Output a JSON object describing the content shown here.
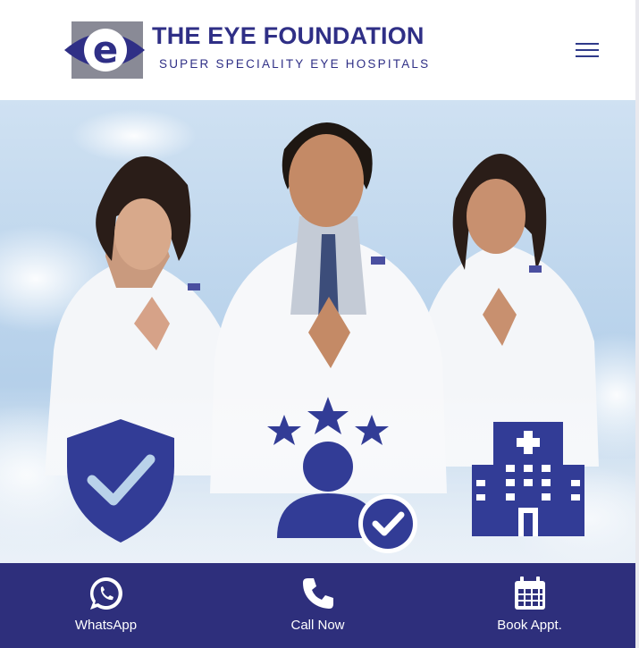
{
  "brand": {
    "logo_letter": "e",
    "title": "THE EYE FOUNDATION",
    "subtitle": "SUPER SPECIALITY EYE HOSPITALS"
  },
  "header": {
    "menu_icon": "hamburger-icon"
  },
  "hero": {
    "image": "doctors-namaste-photo",
    "icons": [
      "shield-check-icon",
      "star-rated-doctor-icon",
      "hospital-building-icon"
    ]
  },
  "bottom_bar": {
    "whatsapp_label": "WhatsApp",
    "call_label": "Call Now",
    "book_label": "Book Appt."
  },
  "colors": {
    "brand_navy": "#2e2f7c",
    "icon_blue": "#323c96",
    "sky": "#b8d4ec"
  }
}
